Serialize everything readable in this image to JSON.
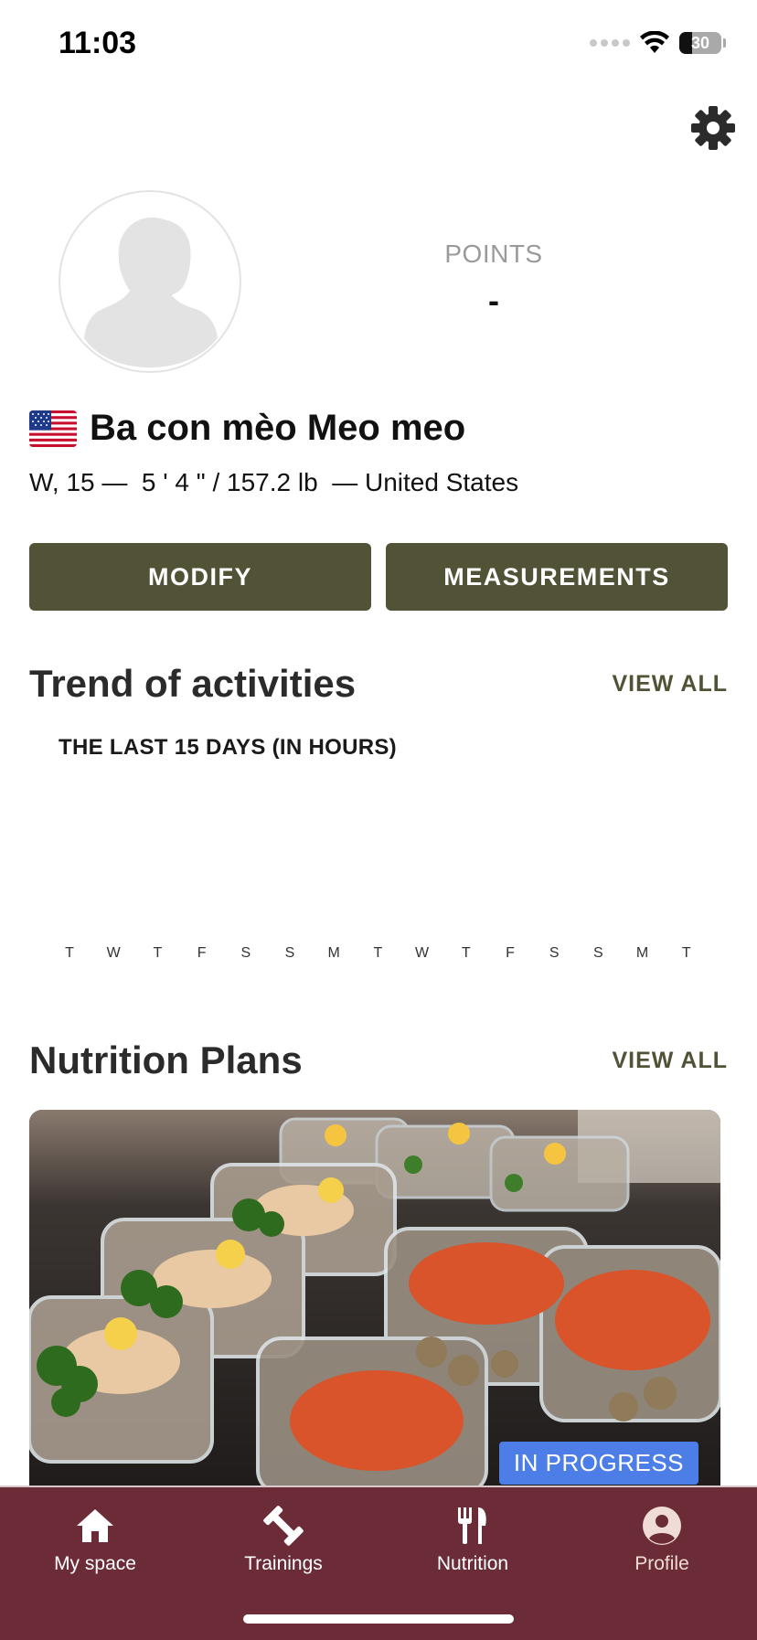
{
  "status_bar": {
    "time": "11:03",
    "battery": "30"
  },
  "profile": {
    "points_label": "POINTS",
    "points_value": "-",
    "name": "Ba con mèo Meo meo",
    "details": "W, 15 —  5 ' 4 \" / 157.2 lb  — United States",
    "flag_icon": "us-flag-icon"
  },
  "actions": {
    "modify_label": "MODIFY",
    "measurements_label": "MEASUREMENTS"
  },
  "activities": {
    "title": "Trend of activities",
    "view_all": "VIEW ALL",
    "subtitle": "THE LAST 15 DAYS (IN HOURS)",
    "days": [
      "T",
      "W",
      "T",
      "F",
      "S",
      "S",
      "M",
      "T",
      "W",
      "T",
      "F",
      "S",
      "S",
      "M",
      "T"
    ]
  },
  "nutrition": {
    "title": "Nutrition Plans",
    "view_all": "VIEW ALL",
    "badge": "IN PROGRESS",
    "badge_color": "#4d7ee8"
  },
  "bottom_nav": {
    "items": [
      {
        "label": "My space",
        "icon": "home-icon"
      },
      {
        "label": "Trainings",
        "icon": "dumbbell-icon"
      },
      {
        "label": "Nutrition",
        "icon": "fork-knife-icon"
      },
      {
        "label": "Profile",
        "icon": "profile-icon",
        "active": true
      }
    ],
    "background": "#6b2c38"
  },
  "colors": {
    "button": "#525237",
    "accent_text": "#525237"
  }
}
